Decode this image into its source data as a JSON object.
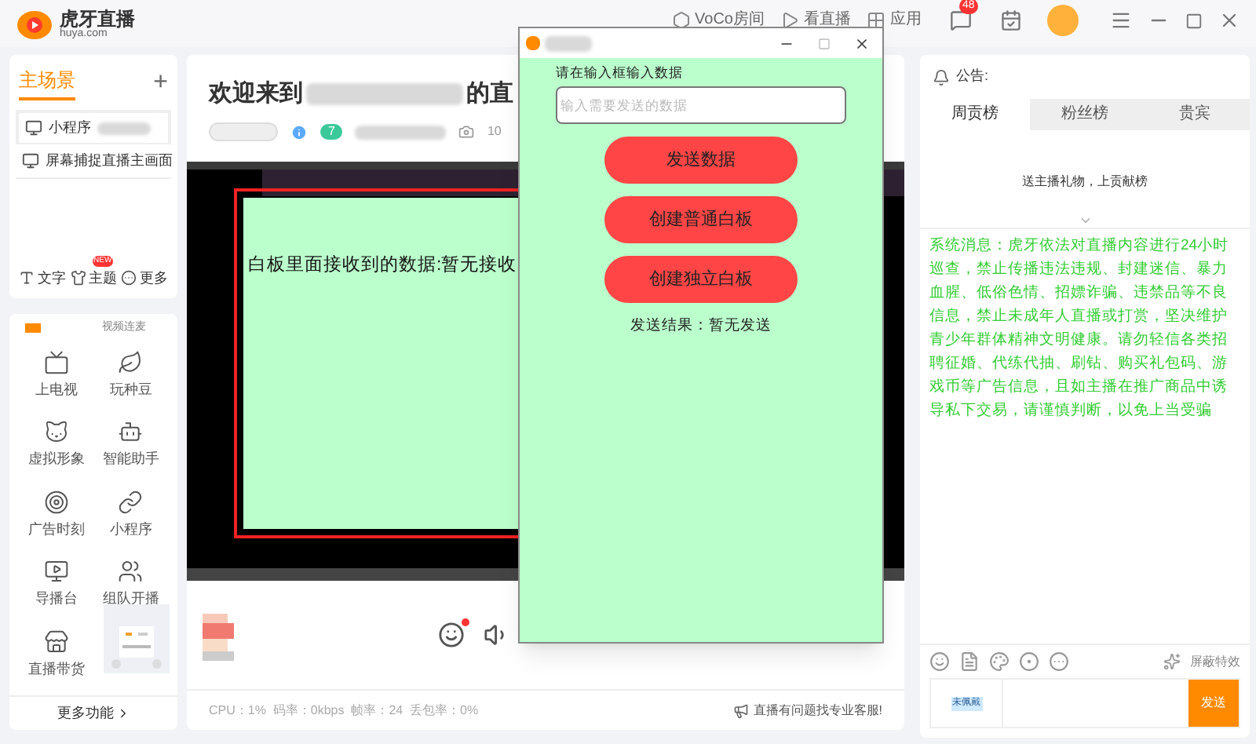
{
  "app": {
    "logo_text": "虎牙直播",
    "logo_sub": "huya.com"
  },
  "top_bar": {
    "items": [
      {
        "label": "VoCo房间",
        "kind": "voco"
      },
      {
        "label": "看直播",
        "kind": "watch"
      },
      {
        "label": "应用",
        "kind": "apps"
      }
    ],
    "message_count": "48"
  },
  "scenes": {
    "title": "主场景",
    "add": "+",
    "items": [
      {
        "label": "小程序",
        "selected": true
      },
      {
        "label": "屏幕捕捉直播主画面",
        "selected": false
      }
    ],
    "actions": [
      {
        "label": "文字",
        "kind": "text"
      },
      {
        "label": "主题",
        "kind": "theme",
        "badge": "NEW"
      },
      {
        "label": "更多",
        "kind": "more"
      }
    ]
  },
  "tools": {
    "tab": "视频连麦",
    "items": [
      {
        "label": "上电视",
        "kind": "tv"
      },
      {
        "label": "玩种豆",
        "kind": "leaf"
      },
      {
        "label": "虚拟形象",
        "kind": "cat"
      },
      {
        "label": "智能助手",
        "kind": "bot"
      },
      {
        "label": "广告时刻",
        "kind": "ad"
      },
      {
        "label": "小程序",
        "kind": "mini"
      },
      {
        "label": "导播台",
        "kind": "director"
      },
      {
        "label": "组队开播",
        "kind": "team"
      },
      {
        "label": "直播带货",
        "kind": "store"
      }
    ],
    "more": "更多功能"
  },
  "stage": {
    "title_start": "欢迎来到",
    "title_end": "的直",
    "fan_badge": "7",
    "viewers": "10",
    "whiteboard_text": "白板里面接收到的数据:暂无接收"
  },
  "status_bar": {
    "stats": "CPU：1%  码率：0kbps  帧率：24  丢包率：0%",
    "help": "直播有问题找专业客服!"
  },
  "right": {
    "notice_label": "公告:",
    "tabs": [
      {
        "label": "周贡榜",
        "selected": true
      },
      {
        "label": "粉丝榜",
        "selected": false
      },
      {
        "label": "贵宾",
        "selected": false
      }
    ],
    "empty_text": "送主播礼物，上贡献榜",
    "system_message": "系统消息：虎牙依法对直播内容进行24小时巡查，禁止传播违法违规、封建迷信、暴力血腥、低俗色情、招嫖诈骗、违禁品等不良信息，禁止未成年人直播或打赏，坚决维护青少年群体精神文明健康。请勿轻信各类招聘征婚、代练代抽、刷钻、购买礼包码、游戏币等广告信息，且如主播在推广商品中诱导私下交易，请谨慎判断，以免上当受骗",
    "block_effects": "屏蔽特效",
    "badge_label": "未佩戴",
    "send": "发送"
  },
  "dialog": {
    "label": "请在输入框输入数据",
    "placeholder": "输入需要发送的数据",
    "buttons": [
      "发送数据",
      "创建普通白板",
      "创建独立白板"
    ],
    "result": "发送结果：暂无发送"
  }
}
